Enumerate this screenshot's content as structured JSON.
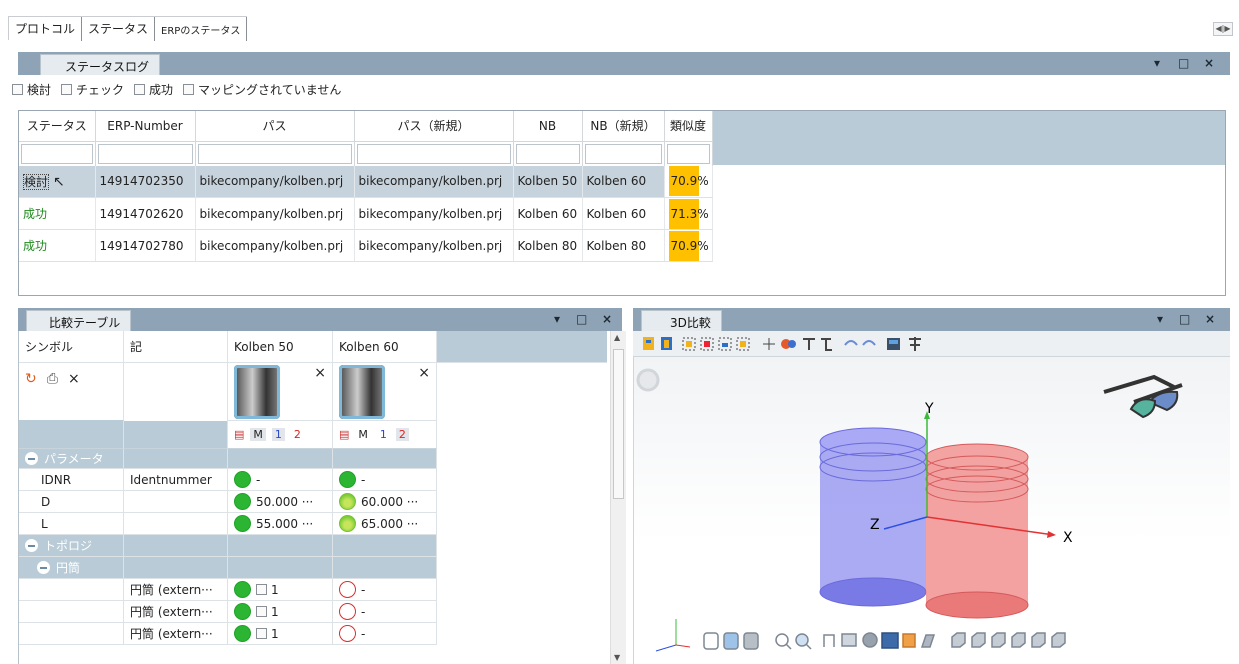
{
  "top_tabs": [
    "プロトコル",
    "ステータス",
    "ERPのステータス"
  ],
  "status_log": {
    "title": "ステータスログ",
    "filters": [
      "検討",
      "チェック",
      "成功",
      "マッピングされていません"
    ],
    "columns": [
      "ステータス",
      "ERP-Number",
      "パス",
      "パス（新規）",
      "NB",
      "NB（新規）",
      "類似度"
    ],
    "rows": [
      {
        "status": "検討",
        "erp": "14914702350",
        "path": "bikecompany/kolben.prj",
        "path_new": "bikecompany/kolben.prj",
        "nb": "Kolben 50",
        "nb_new": "Kolben 60",
        "similarity": "70.9%"
      },
      {
        "status": "成功",
        "erp": "14914702620",
        "path": "bikecompany/kolben.prj",
        "path_new": "bikecompany/kolben.prj",
        "nb": "Kolben 60",
        "nb_new": "Kolben 60",
        "similarity": "71.3%"
      },
      {
        "status": "成功",
        "erp": "14914702780",
        "path": "bikecompany/kolben.prj",
        "path_new": "bikecompany/kolben.prj",
        "nb": "Kolben 80",
        "nb_new": "Kolben 80",
        "similarity": "70.9%"
      }
    ]
  },
  "compare_table": {
    "title": "比較テーブル",
    "col_symbol": "シンボル",
    "col_note": "記",
    "col_a": "Kolben 50",
    "col_b": "Kolben 60",
    "close_glyph": "×",
    "mode_m": "M",
    "mode_1": "1",
    "mode_2": "2",
    "group_params": "パラメータ",
    "params": [
      {
        "symbol": "IDNR",
        "note": "Identnummer",
        "a": "-",
        "b": "-"
      },
      {
        "symbol": "D",
        "note": "",
        "a": "50.000 ···",
        "b": "60.000 ···"
      },
      {
        "symbol": "L",
        "note": "",
        "a": "55.000 ···",
        "b": "65.000 ···"
      }
    ],
    "group_topology": "トポロジ",
    "subgroup_cylinder": "円筒",
    "cyl_rows": [
      {
        "note": "円筒 (extern···",
        "a": "1",
        "b": "-"
      },
      {
        "note": "円筒 (extern···",
        "a": "1",
        "b": "-"
      },
      {
        "note": "円筒 (extern···",
        "a": "1",
        "b": "-"
      }
    ]
  },
  "view3d": {
    "title": "3D比較",
    "axis_x": "X",
    "axis_y": "Y",
    "axis_z": "Z",
    "colors": {
      "cyl_a": "#8f8ff0",
      "cyl_b": "#f08a8a"
    }
  },
  "window_buttons": [
    "▾",
    "□",
    "×"
  ]
}
